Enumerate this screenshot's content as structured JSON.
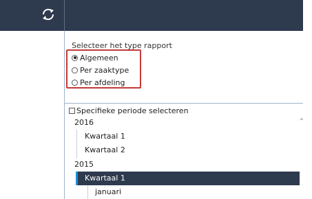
{
  "toolbar": {
    "refresh_icon": "refresh-icon"
  },
  "report_type": {
    "title": "Selecteer het type rapport",
    "options": [
      {
        "label": "Algemeen",
        "selected": true
      },
      {
        "label": "Per zaaktype",
        "selected": false
      },
      {
        "label": "Per afdeling",
        "selected": false
      }
    ],
    "highlight_color": "#c23a3a"
  },
  "period": {
    "checkbox_label": "Specifieke periode selecteren",
    "checked": false,
    "tree": [
      {
        "label": "2016"
      },
      {
        "label": "Kwartaal 1"
      },
      {
        "label": "Kwartaal 2"
      },
      {
        "label": "2015"
      },
      {
        "label": "Kwartaal 1",
        "selected": true
      },
      {
        "label": "januari"
      }
    ]
  },
  "colors": {
    "header": "#2e3a4e",
    "selection": "#2e3a4e",
    "accent": "#1f8fd6"
  }
}
